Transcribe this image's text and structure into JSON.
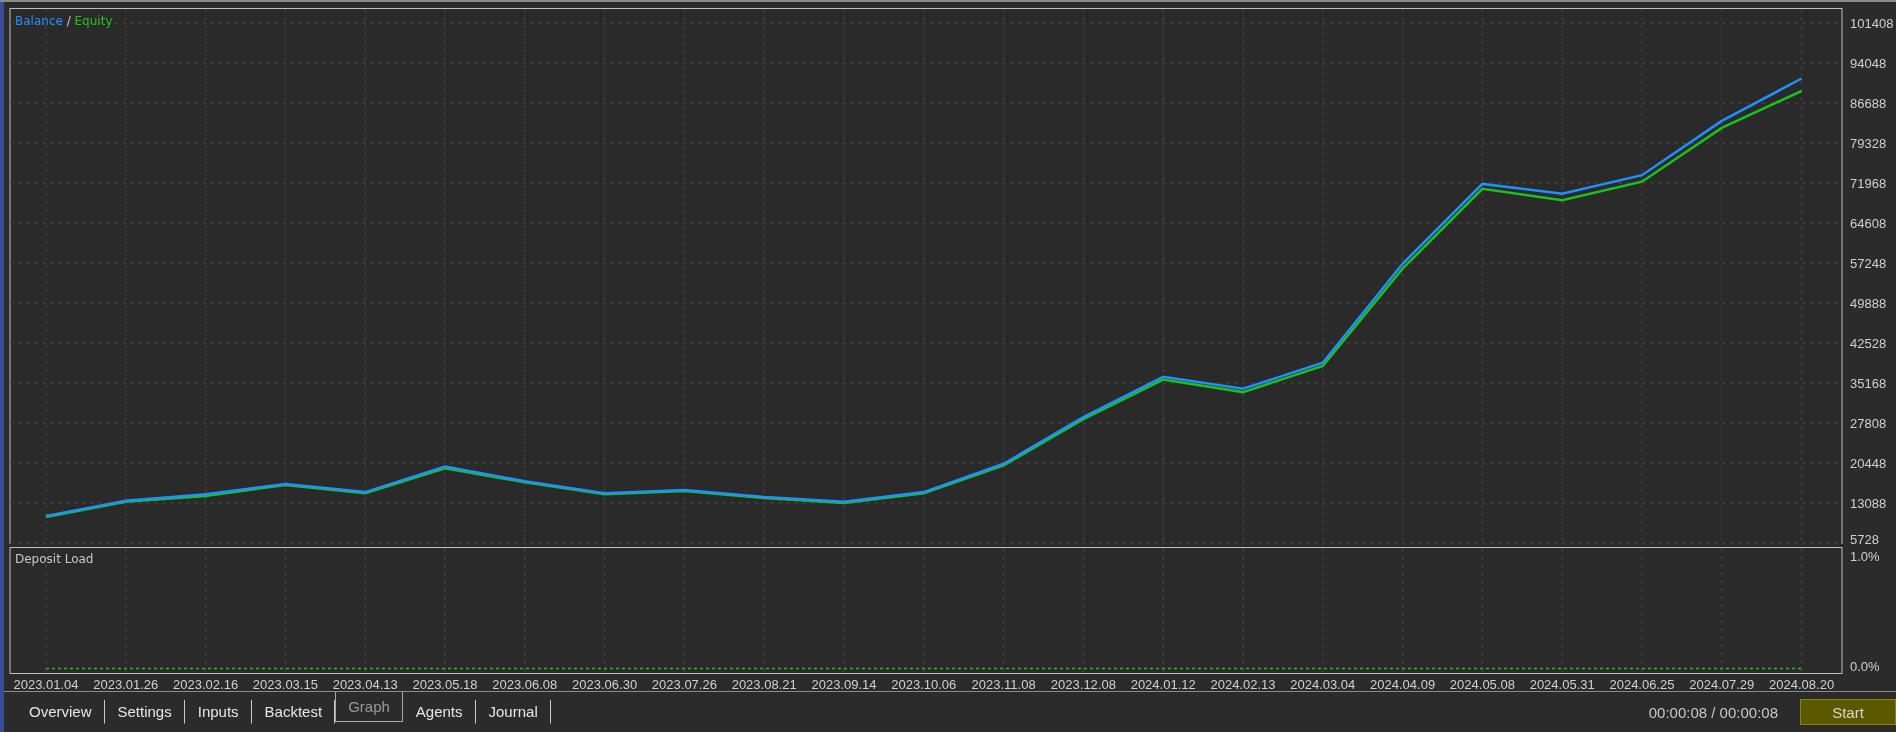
{
  "balance_chart": {
    "legend_separator": "/",
    "chart_data": {
      "type": "line",
      "grid": true,
      "series": [
        {
          "name": "Balance",
          "color": "#1e90ff",
          "values": [
            10700,
            13500,
            14700,
            16600,
            15100,
            19800,
            17100,
            14900,
            15500,
            14200,
            13300,
            15100,
            20300,
            28900,
            36300,
            34100,
            38900,
            57100,
            71800,
            70000,
            73400,
            83400,
            91200
          ]
        },
        {
          "name": "Equity",
          "color": "#1ec01e",
          "values": [
            10500,
            13300,
            14400,
            16400,
            14900,
            19500,
            16900,
            14700,
            15300,
            14000,
            13100,
            14900,
            20000,
            28500,
            35800,
            33500,
            38300,
            56200,
            70900,
            68800,
            72200,
            82100,
            88900
          ]
        }
      ],
      "ylim": [
        5728,
        101408
      ],
      "yticks": [
        5728,
        13088,
        20448,
        27808,
        35168,
        42528,
        49888,
        57248,
        64608,
        71968,
        79328,
        86688,
        94048,
        101408
      ]
    }
  },
  "deposit_chart": {
    "chart_data": {
      "type": "line",
      "title": "Deposit Load",
      "grid": true,
      "categories": [
        "2023.01.04",
        "2023.01.26",
        "2023.02.16",
        "2023.03.15",
        "2023.04.13",
        "2023.05.18",
        "2023.06.08",
        "2023.06.30",
        "2023.07.26",
        "2023.08.21",
        "2023.09.14",
        "2023.10.06",
        "2023.11.08",
        "2023.12.08",
        "2024.01.12",
        "2024.02.13",
        "2024.03.04",
        "2024.04.09",
        "2024.05.08",
        "2024.05.31",
        "2024.06.25",
        "2024.07.29",
        "2024.08.20"
      ],
      "series": [
        {
          "color": "#1ec01e",
          "line_style": "dashed",
          "values": [
            0,
            0,
            0,
            0,
            0,
            0,
            0,
            0,
            0,
            0,
            0,
            0,
            0,
            0,
            0,
            0,
            0,
            0,
            0,
            0,
            0,
            0,
            0
          ]
        }
      ],
      "ylim": [
        -0.05,
        1.1
      ],
      "yticks": [
        {
          "value": 0,
          "label": "0.0%"
        },
        {
          "value": 1,
          "label": "1.0%"
        }
      ]
    }
  },
  "tabs": [
    {
      "label": "Overview",
      "selected": false
    },
    {
      "label": "Settings",
      "selected": false
    },
    {
      "label": "Inputs",
      "selected": false
    },
    {
      "label": "Backtest",
      "selected": false
    },
    {
      "label": "Graph",
      "selected": true
    },
    {
      "label": "Agents",
      "selected": false
    },
    {
      "label": "Journal",
      "selected": false
    }
  ],
  "elapsed": "00:00:08 / 00:00:08",
  "start_button": "Start"
}
